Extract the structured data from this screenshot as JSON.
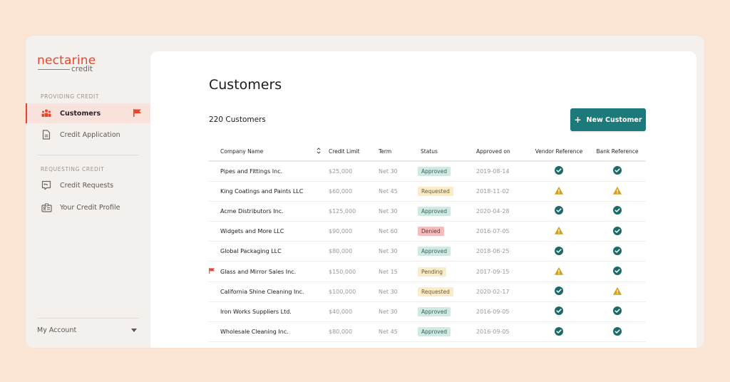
{
  "brand": {
    "name": "nectarine",
    "sub": "credit",
    "accent": "#e8452c"
  },
  "sidebar": {
    "sections": [
      {
        "label": "PROVIDING CREDIT",
        "items": [
          {
            "label": "Customers",
            "icon": "people-icon",
            "active": true,
            "flagged": true
          },
          {
            "label": "Credit Application",
            "icon": "document-icon",
            "active": false
          }
        ]
      },
      {
        "label": "REQUESTING CREDIT",
        "items": [
          {
            "label": "Credit Requests",
            "icon": "request-icon",
            "active": false
          },
          {
            "label": "Your Credit Profile",
            "icon": "id-card-icon",
            "active": false
          }
        ]
      }
    ],
    "account_label": "My Account"
  },
  "main": {
    "title": "Customers",
    "count_label": "220 Customers",
    "new_button_label": "New Customer",
    "primary_color": "#1d7a7a",
    "table": {
      "columns": [
        "Company Name",
        "Credit Limit",
        "Term",
        "Status",
        "Approved on",
        "Vendor Reference",
        "Bank Reference"
      ],
      "rows": [
        {
          "flag": false,
          "company": "Pipes and Fittings Inc.",
          "limit": "$25,000",
          "term": "Net 30",
          "status": "Approved",
          "approved_on": "2019-08-14",
          "vendor_ref": "ok",
          "bank_ref": "ok"
        },
        {
          "flag": false,
          "company": "King Coatings and Paints LLC",
          "limit": "$60,000",
          "term": "Net 45",
          "status": "Requested",
          "approved_on": "2018-11-02",
          "vendor_ref": "warning",
          "bank_ref": "warning"
        },
        {
          "flag": false,
          "company": "Acme Distributors Inc.",
          "limit": "$125,000",
          "term": "Net 30",
          "status": "Approved",
          "approved_on": "2020-04-28",
          "vendor_ref": "ok",
          "bank_ref": "ok"
        },
        {
          "flag": false,
          "company": "Widgets and More LLC",
          "limit": "$90,000",
          "term": "Net 60",
          "status": "Denied",
          "approved_on": "2016-07-05",
          "vendor_ref": "warning",
          "bank_ref": "ok"
        },
        {
          "flag": false,
          "company": "Global Packaging LLC",
          "limit": "$80,000",
          "term": "Net 30",
          "status": "Approved",
          "approved_on": "2018-06-25",
          "vendor_ref": "ok",
          "bank_ref": "ok"
        },
        {
          "flag": true,
          "company": "Glass and Mirror Sales Inc.",
          "limit": "$150,000",
          "term": "Net 15",
          "status": "Pending",
          "approved_on": "2017-09-15",
          "vendor_ref": "warning",
          "bank_ref": "ok"
        },
        {
          "flag": false,
          "company": "California Shine Cleaning Inc.",
          "limit": "$100,000",
          "term": "Net 30",
          "status": "Requested",
          "approved_on": "2020-02-17",
          "vendor_ref": "ok",
          "bank_ref": "warning"
        },
        {
          "flag": false,
          "company": "Iron Works Suppliers Ltd.",
          "limit": "$40,000",
          "term": "Net 30",
          "status": "Approved",
          "approved_on": "2016-09-05",
          "vendor_ref": "ok",
          "bank_ref": "ok"
        },
        {
          "flag": false,
          "company": "Wholesale Cleaning Inc.",
          "limit": "$80,000",
          "term": "Net 45",
          "status": "Approved",
          "approved_on": "2016-09-05",
          "vendor_ref": "ok",
          "bank_ref": "ok"
        }
      ]
    }
  }
}
